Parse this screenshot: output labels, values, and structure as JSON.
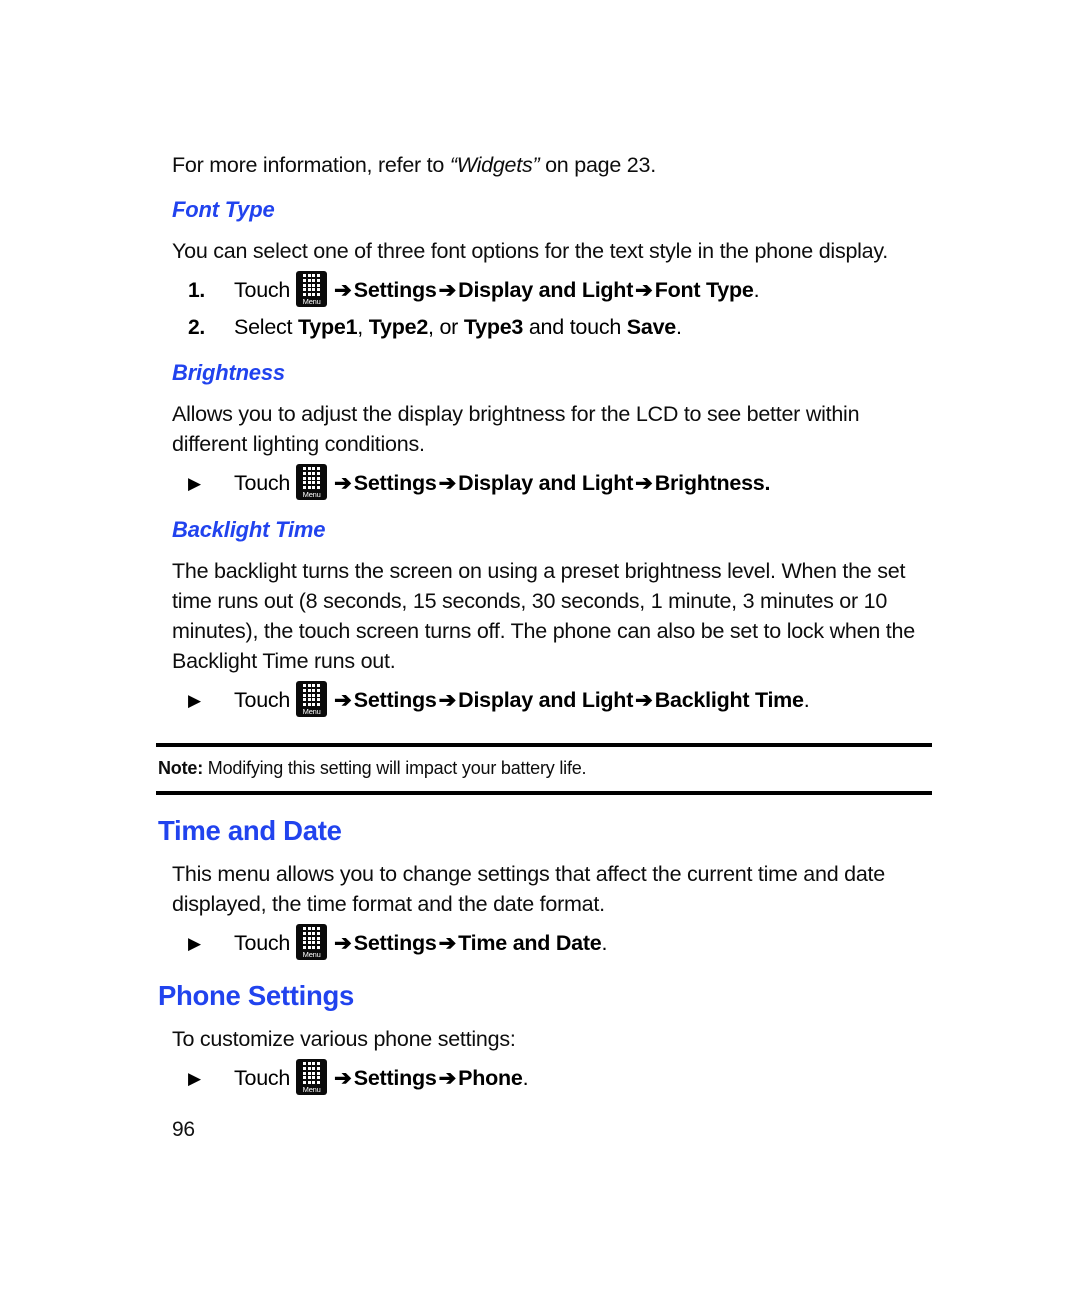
{
  "page": {
    "number": "96"
  },
  "intro": {
    "before": "For more information, refer to ",
    "quoted": "“Widgets”",
    "after": " on page 23."
  },
  "sections": [
    {
      "id": "font-type",
      "heading": "Font Type",
      "body": "You can select one of three font options for the text style in the phone display.",
      "steps": [
        {
          "marker": "1.",
          "touch": "Touch",
          "icon": "menu-key-icon",
          "icon_label": "Menu",
          "path": [
            "Settings",
            "Display and Light",
            "Font Type"
          ],
          "period": "."
        },
        {
          "marker": "2.",
          "plain_prefix": "Select ",
          "bold_1": "Type1",
          "sep_1": ", ",
          "bold_2": "Type2",
          "sep_2": ", or ",
          "bold_3": "Type3",
          "plain_mid": " and touch ",
          "bold_4": "Save",
          "period": "."
        }
      ]
    },
    {
      "id": "brightness",
      "heading": "Brightness",
      "body": "Allows you to adjust the display brightness for the LCD to see better within different lighting conditions.",
      "steps": [
        {
          "marker": "▶",
          "touch": "Touch",
          "icon": "menu-key-icon",
          "icon_label": "Menu",
          "path": [
            "Settings",
            "Display and Light",
            "Brightness."
          ],
          "period": ""
        }
      ]
    },
    {
      "id": "backlight-time",
      "heading": "Backlight Time",
      "body": "The backlight turns the screen on using a preset brightness level. When the set time runs out (8 seconds, 15 seconds, 30 seconds, 1 minute, 3 minutes or 10 minutes), the touch screen turns off. The phone can also be set to lock when the Backlight Time runs out.",
      "steps": [
        {
          "marker": "▶",
          "touch": "Touch",
          "icon": "menu-key-icon",
          "icon_label": "Menu",
          "path": [
            "Settings",
            "Display and Light",
            "Backlight Time"
          ],
          "period": "."
        }
      ]
    }
  ],
  "note": {
    "label": "Note:",
    "text": " Modifying this setting will impact your battery life."
  },
  "main_sections": [
    {
      "id": "time-and-date",
      "heading": "Time and Date",
      "body": "This menu allows you to change settings that affect the current time and date displayed, the time format and the date format.",
      "steps": [
        {
          "marker": "▶",
          "touch": "Touch",
          "icon": "menu-key-icon",
          "icon_label": "Menu",
          "path": [
            "Settings",
            "Time and Date"
          ],
          "period": "."
        }
      ]
    },
    {
      "id": "phone-settings",
      "heading": "Phone Settings",
      "body": "To customize various phone settings:",
      "steps": [
        {
          "marker": "▶",
          "touch": "Touch",
          "icon": "menu-key-icon",
          "icon_label": "Menu",
          "path": [
            "Settings",
            "Phone"
          ],
          "period": "."
        }
      ]
    }
  ],
  "glyphs": {
    "arrow": "➔",
    "triangle": "▶"
  },
  "colors": {
    "heading_blue": "#2143ee",
    "body_black": "#0d0d0d",
    "menu_key_bg": "#0a0a0a"
  }
}
